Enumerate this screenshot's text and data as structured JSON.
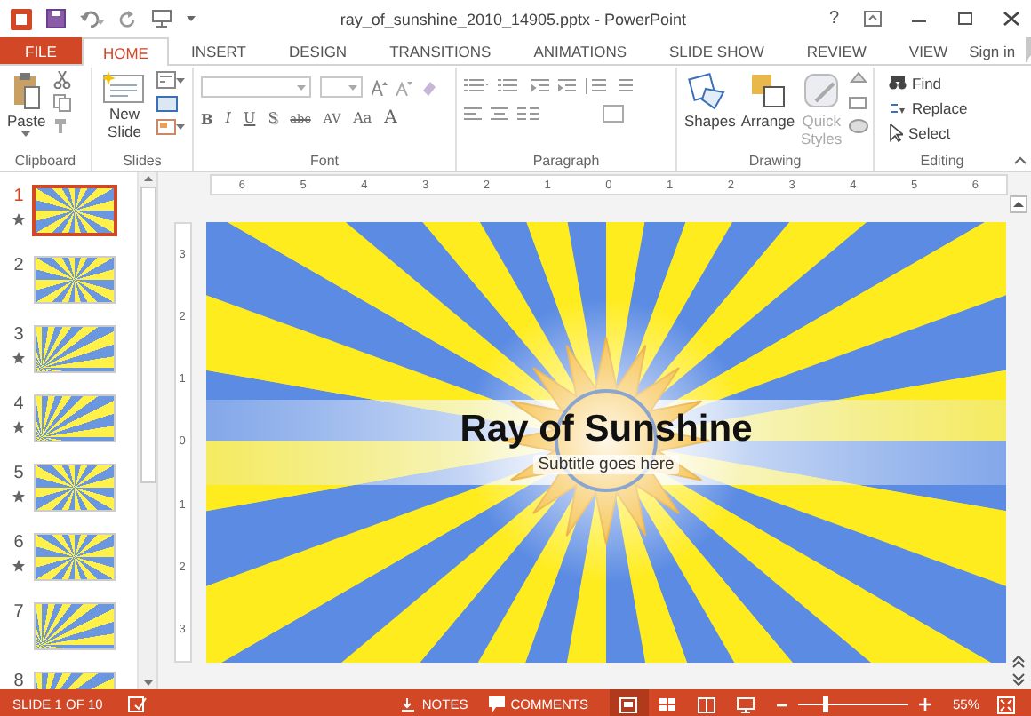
{
  "window": {
    "title": "ray_of_sunshine_2010_14905.pptx - PowerPoint",
    "help": "?"
  },
  "tabs": [
    {
      "label": "FILE",
      "kind": "file",
      "selected": false
    },
    {
      "label": "HOME",
      "kind": "tab",
      "selected": true
    },
    {
      "label": "INSERT",
      "kind": "tab",
      "selected": false
    },
    {
      "label": "DESIGN",
      "kind": "tab",
      "selected": false
    },
    {
      "label": "TRANSITIONS",
      "kind": "tab",
      "selected": false
    },
    {
      "label": "ANIMATIONS",
      "kind": "tab",
      "selected": false
    },
    {
      "label": "SLIDE SHOW",
      "kind": "tab",
      "selected": false
    },
    {
      "label": "REVIEW",
      "kind": "tab",
      "selected": false
    },
    {
      "label": "VIEW",
      "kind": "tab",
      "selected": false
    }
  ],
  "account": {
    "sign_in": "Sign in"
  },
  "ribbon": {
    "clipboard": {
      "label": "Clipboard",
      "paste": "Paste"
    },
    "slides": {
      "label": "Slides",
      "new_slide": "New Slide"
    },
    "font": {
      "label": "Font",
      "format_buttons": [
        {
          "label": "B",
          "kind": "bold"
        },
        {
          "label": "I",
          "kind": "italic"
        },
        {
          "label": "U",
          "kind": "underline"
        },
        {
          "label": "S",
          "kind": "shadow"
        },
        {
          "label": "abc",
          "kind": "strike"
        },
        {
          "label": "AV",
          "kind": "spacing"
        },
        {
          "label": "Aa",
          "kind": "case"
        },
        {
          "label": "A",
          "kind": "color"
        }
      ]
    },
    "paragraph": {
      "label": "Paragraph"
    },
    "drawing": {
      "label": "Drawing",
      "buttons": [
        {
          "label": "Shapes",
          "kind": "shapes",
          "disabled": false
        },
        {
          "label": "Arrange",
          "kind": "arrange",
          "disabled": false
        },
        {
          "label": "Quick Styles",
          "kind": "styles",
          "disabled": true
        }
      ]
    },
    "editing": {
      "label": "Editing",
      "buttons": [
        {
          "label": "Find",
          "kind": "find"
        },
        {
          "label": "Replace",
          "kind": "replace"
        },
        {
          "label": "Select",
          "kind": "select"
        }
      ]
    }
  },
  "horizontal_ruler": [
    "6",
    "5",
    "4",
    "3",
    "2",
    "1",
    "0",
    "1",
    "2",
    "3",
    "4",
    "5",
    "6"
  ],
  "vertical_ruler": [
    "3",
    "2",
    "1",
    "0",
    "1",
    "2",
    "3"
  ],
  "slides": [
    {
      "number": "1",
      "starred": true,
      "selected": true,
      "kind": "center"
    },
    {
      "number": "2",
      "starred": false,
      "selected": false,
      "kind": "center"
    },
    {
      "number": "3",
      "starred": true,
      "selected": false,
      "kind": "corner"
    },
    {
      "number": "4",
      "starred": true,
      "selected": false,
      "kind": "corner"
    },
    {
      "number": "5",
      "starred": true,
      "selected": false,
      "kind": "center"
    },
    {
      "number": "6",
      "starred": true,
      "selected": false,
      "kind": "center"
    },
    {
      "number": "7",
      "starred": false,
      "selected": false,
      "kind": "corner"
    },
    {
      "number": "8",
      "starred": false,
      "selected": false,
      "kind": "corner"
    }
  ],
  "current_slide": {
    "title": "Ray of Sunshine",
    "subtitle": "Subtitle goes here"
  },
  "status_bar": {
    "slide_indicator": "SLIDE 1 OF 10",
    "notes": "NOTES",
    "comments": "COMMENTS",
    "views": [
      {
        "kind": "normal",
        "selected": true
      },
      {
        "kind": "sorter",
        "selected": false
      },
      {
        "kind": "reading",
        "selected": false
      },
      {
        "kind": "slideshow",
        "selected": false
      }
    ],
    "zoom": {
      "level": 0.25,
      "reading": "55%"
    }
  }
}
